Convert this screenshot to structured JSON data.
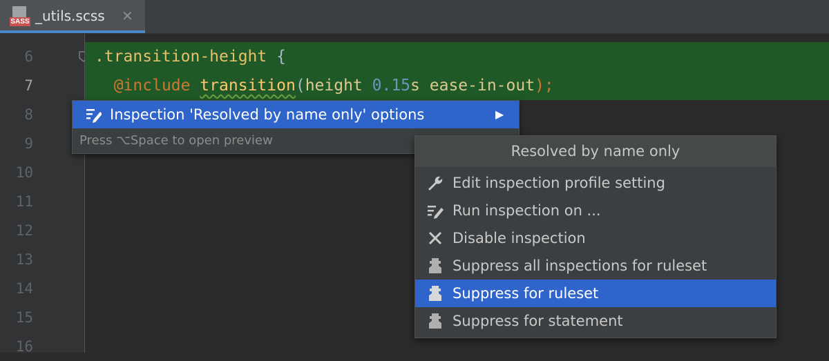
{
  "tab": {
    "title": "_utils.scss",
    "badge": "SASS",
    "close": "✕"
  },
  "gutter": {
    "line_numbers": [
      "6",
      "7",
      "8",
      "9",
      "10",
      "11",
      "12",
      "13",
      "14",
      "15",
      "16"
    ],
    "current_line": "7"
  },
  "code": {
    "line6": {
      "selector": ".transition-height",
      "brace": " {"
    },
    "line7": {
      "indent": "  ",
      "keyword": "@include",
      "func": "transition",
      "open": "(",
      "arg1": "height",
      "num": "0.15",
      "unit": "s",
      "arg2": "ease-in-out",
      "close": ");"
    }
  },
  "intention_popup": {
    "item_label": "Inspection 'Resolved by name only' options",
    "hint": "Press ⌥Space to open preview",
    "arrow": "▶"
  },
  "submenu": {
    "title": "Resolved by name only",
    "items": [
      {
        "label": "Edit inspection profile setting",
        "icon": "wrench-icon"
      },
      {
        "label": "Run inspection on ...",
        "icon": "edit-lines-icon"
      },
      {
        "label": "Disable inspection",
        "icon": "close-icon"
      },
      {
        "label": "Suppress all inspections for ruleset",
        "icon": "suppress-icon"
      },
      {
        "label": "Suppress for ruleset",
        "icon": "suppress-icon"
      },
      {
        "label": "Suppress for statement",
        "icon": "suppress-icon"
      }
    ],
    "selected_index": 4
  },
  "colors": {
    "editor_bg": "#2b2b2b",
    "highlight_bg": "#1f5927",
    "selection": "#2f65ca",
    "selector": "#e8bf6a",
    "keyword": "#cc7832",
    "function": "#ffc66d",
    "number": "#6897bb"
  }
}
